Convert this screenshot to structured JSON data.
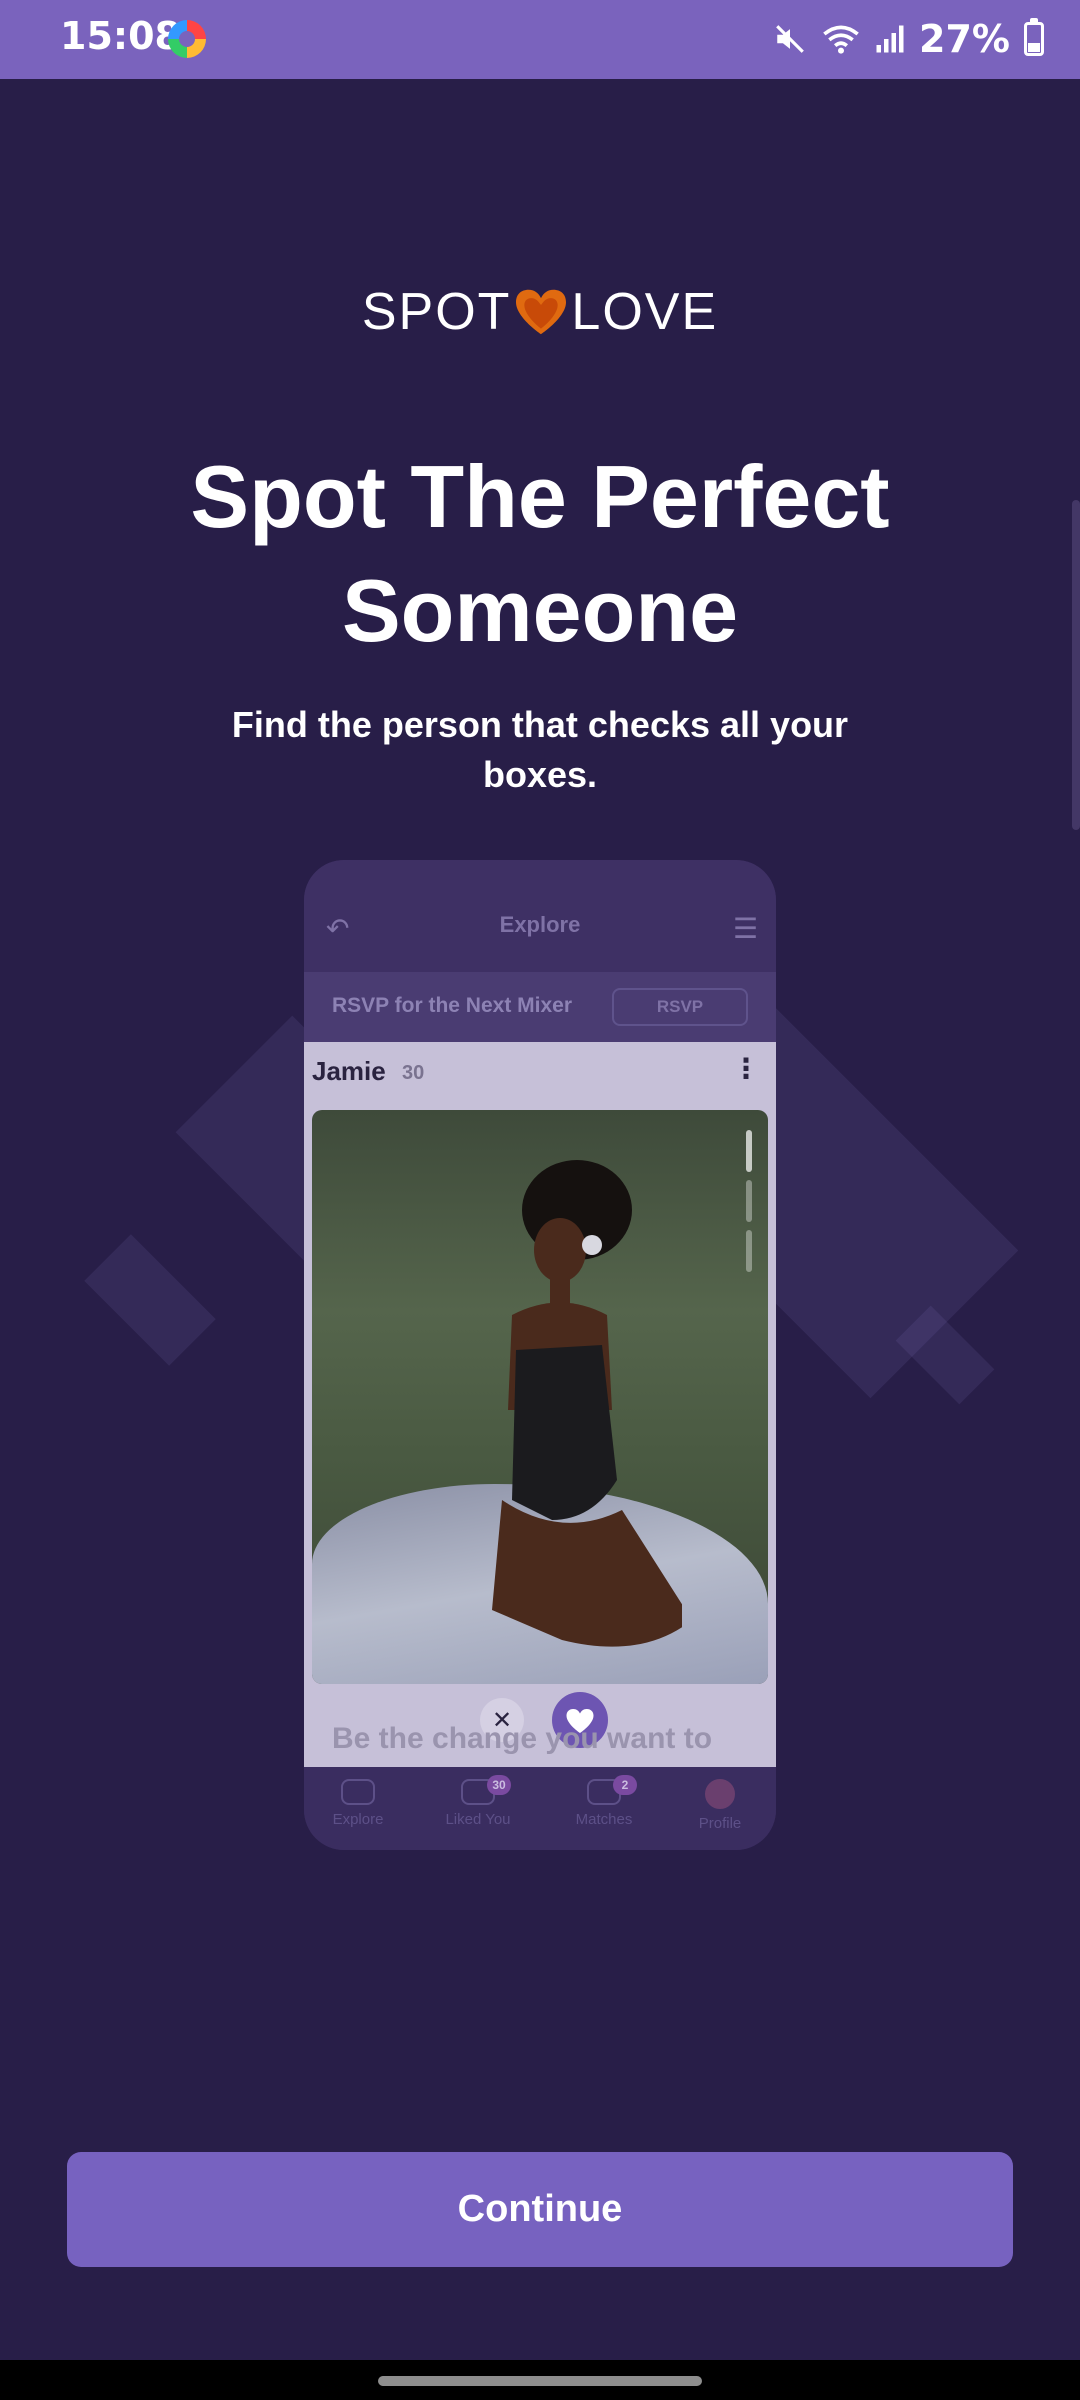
{
  "status_bar": {
    "time": "15:08",
    "battery": "27%"
  },
  "logo": {
    "left": "SPOT",
    "right": "LOVE"
  },
  "title_line1": "Spot The Perfect",
  "title_line2": "Someone",
  "subtitle": "Find the person that checks all your boxes.",
  "preview": {
    "header_title": "Explore",
    "rsvp_text": "RSVP for the Next Mixer",
    "rsvp_button": "RSVP",
    "profile_name": "Jamie",
    "profile_age": "30",
    "teaser_text": "Be the change you want to",
    "nav": [
      {
        "label": "Explore",
        "badge": ""
      },
      {
        "label": "Liked You",
        "badge": "30"
      },
      {
        "label": "Matches",
        "badge": "2"
      },
      {
        "label": "Profile",
        "badge": ""
      }
    ]
  },
  "continue_label": "Continue",
  "colors": {
    "background": "#281e48",
    "accent": "#7762c0",
    "status_bar": "#7a63bd",
    "heart": "#e06a10"
  }
}
